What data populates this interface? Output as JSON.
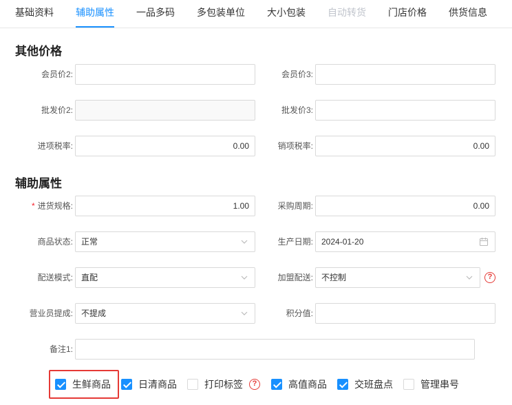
{
  "tabs": [
    "基础资料",
    "辅助属性",
    "一品多码",
    "多包装单位",
    "大小包装",
    "自动转货",
    "门店价格",
    "供货信息"
  ],
  "sections": {
    "other_prices": "其他价格",
    "aux_attrs": "辅助属性"
  },
  "fields": {
    "member_price2": {
      "label": "会员价2:",
      "value": ""
    },
    "member_price3": {
      "label": "会员价3:",
      "value": ""
    },
    "wholesale_price2": {
      "label": "批发价2:",
      "value": ""
    },
    "wholesale_price3": {
      "label": "批发价3:",
      "value": ""
    },
    "input_tax": {
      "label": "进项税率:",
      "value": "0.00"
    },
    "output_tax": {
      "label": "销项税率:",
      "value": "0.00"
    },
    "purchase_spec": {
      "label": "进货规格:",
      "required_mark": "*",
      "value": "1.00"
    },
    "purchase_cycle": {
      "label": "采购周期:",
      "value": "0.00"
    },
    "product_status": {
      "label": "商品状态:",
      "value": "正常"
    },
    "production_date": {
      "label": "生产日期:",
      "value": "2024-01-20"
    },
    "delivery_mode": {
      "label": "配送模式:",
      "value": "直配"
    },
    "franchise_delivery": {
      "label": "加盟配送:",
      "value": "不控制"
    },
    "sales_commission": {
      "label": "营业员提成:",
      "value": "不提成"
    },
    "points": {
      "label": "积分值:",
      "value": ""
    },
    "remark1": {
      "label": "备注1:",
      "value": ""
    }
  },
  "help_icon_glyph": "?",
  "checkboxes": [
    {
      "label": "生鲜商品",
      "checked": true
    },
    {
      "label": "日清商品",
      "checked": true
    },
    {
      "label": "打印标签",
      "checked": false
    },
    {
      "label": "高值商品",
      "checked": true
    },
    {
      "label": "交班盘点",
      "checked": true
    },
    {
      "label": "管理串号",
      "checked": false
    }
  ],
  "colors": {
    "accent": "#1890ff",
    "highlight": "#e53935",
    "required": "#f5222d"
  }
}
